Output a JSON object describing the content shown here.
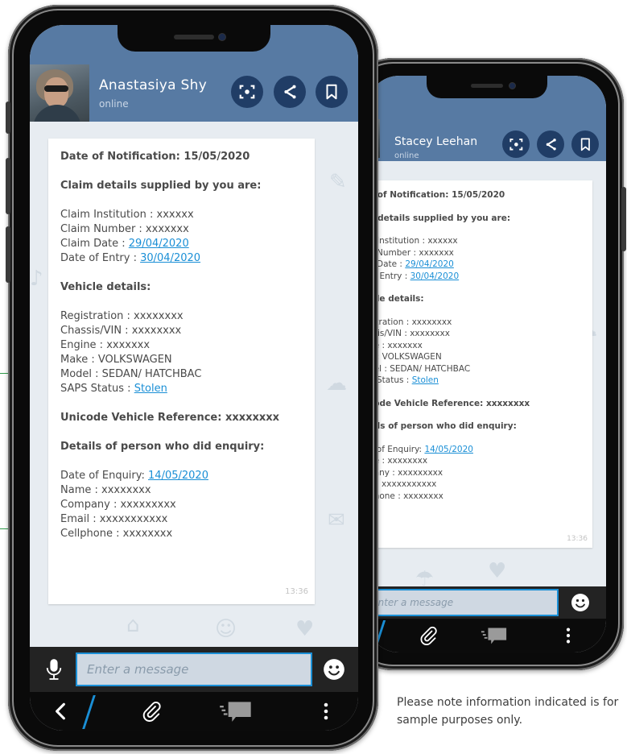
{
  "front_phone": {
    "contact_name": "Anastasiya Shy",
    "contact_status": "online",
    "message": {
      "title_line": "Date of Notification: 15/05/2020",
      "claim_heading": "Claim details supplied by you are:",
      "claim_institution": "Claim Institution : xxxxxx",
      "claim_number": "Claim Number : xxxxxxx",
      "claim_date_label": "Claim Date : ",
      "claim_date_value": "29/04/2020",
      "date_of_entry_label": "Date of Entry : ",
      "date_of_entry_value": "30/04/2020",
      "vehicle_heading": "Vehicle details:",
      "registration": "Registration : xxxxxxxx",
      "chassis": "Chassis/VIN : xxxxxxxx",
      "engine": "Engine : xxxxxxx",
      "make": "Make : VOLKSWAGEN",
      "model": "Model :  SEDAN/ HATCHBAC",
      "saps_label": "SAPS Status : ",
      "saps_value": "Stolen",
      "unicode_reference": "Unicode Vehicle Reference: xxxxxxxx",
      "enquiry_heading": "Details of person who did enquiry:",
      "enquiry_date_label": "Date of Enquiry: ",
      "enquiry_date_value": "14/05/2020",
      "name": "Name : xxxxxxxx",
      "company": "Company : xxxxxxxxx",
      "email": "Email : xxxxxxxxxxx",
      "cellphone": "Cellphone : xxxxxxxx",
      "time": "13:36"
    },
    "input_placeholder": "Enter a message"
  },
  "back_phone": {
    "contact_name": "Stacey Leehan",
    "contact_status": "online",
    "message": {
      "title_line": "e of Notification: 15/05/2020",
      "claim_heading": "n details supplied by you are:",
      "claim_institution": "n Institution : xxxxxx",
      "claim_number": "n Number : xxxxxxx",
      "claim_date_label": "n Date : ",
      "claim_date_value": "29/04/2020",
      "date_of_entry_label": "of Entry : ",
      "date_of_entry_value": "30/04/2020",
      "vehicle_heading": "icle details:",
      "registration": "istration : xxxxxxxx",
      "chassis": "ssis/VIN : xxxxxxxx",
      "engine": "ne : xxxxxxx",
      "make": "e : VOLKSWAGEN",
      "model": "del :  SEDAN/ HATCHBAC",
      "saps_label": "S Status : ",
      "saps_value": "Stolen",
      "unicode_reference": "code Vehicle Reference: xxxxxxxx",
      "enquiry_heading": "ails of person who did enquiry:",
      "enquiry_date_label": "e of Enquiry: ",
      "enquiry_date_value": "14/05/2020",
      "name": "ne : xxxxxxxx",
      "company": "pany : xxxxxxxxx",
      "email": "il : xxxxxxxxxxx",
      "cellphone": "phone : xxxxxxxx",
      "time": "13:36"
    },
    "input_placeholder": "Enter a message"
  },
  "caption": "Please note information indicated is for sample purposes only.",
  "icons": {
    "header": [
      "scan-icon",
      "share-icon",
      "bookmark-icon"
    ],
    "input": [
      "microphone-icon",
      "emoji-icon"
    ],
    "nav": [
      "back-icon",
      "attach-icon",
      "chat-icon",
      "more-icon"
    ]
  },
  "colors": {
    "header": "#577aa3",
    "header_button": "#203d66",
    "link": "#1a8fd6",
    "wallpaper": "#e7ecf1",
    "input_bar": "#232323",
    "input_field": "#cfd8e2"
  }
}
